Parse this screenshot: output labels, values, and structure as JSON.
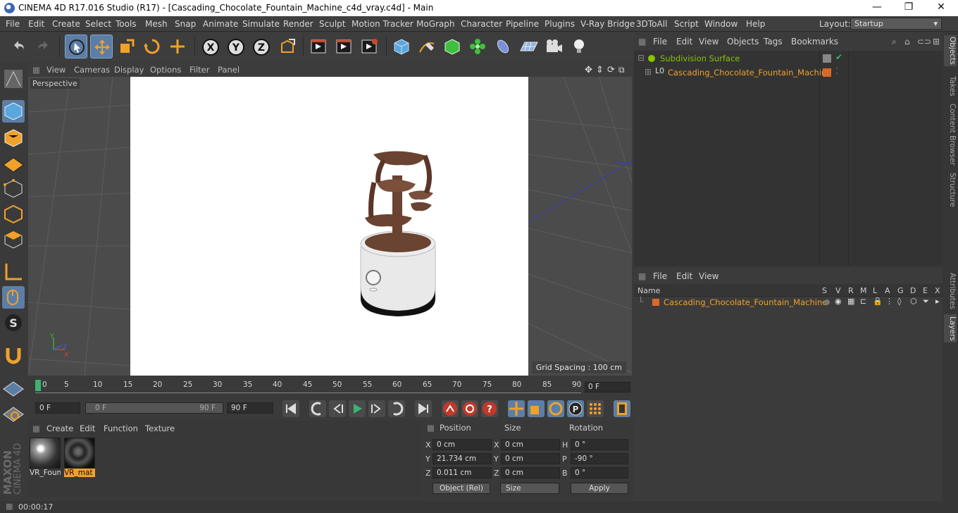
{
  "titlebar": {
    "title": "CINEMA 4D R17.016 Studio (R17) - [Cascading_Chocolate_Fountain_Machine_c4d_vray.c4d] - Main",
    "minimize": "—",
    "maximize": "❐",
    "close": "✕"
  },
  "menu": [
    "File",
    "Edit",
    "Create",
    "Select",
    "Tools",
    "Mesh",
    "Snap",
    "Animate",
    "Simulate",
    "Render",
    "Sculpt",
    "Motion Tracker",
    "MoGraph",
    "Character",
    "Pipeline",
    "Plugins",
    "V-Ray Bridge",
    "3DToAll",
    "Script",
    "Window",
    "Help"
  ],
  "layout": {
    "label": "Layout:",
    "value": "Startup"
  },
  "viewport": {
    "menu": [
      "View",
      "Cameras",
      "Display",
      "Options",
      "Filter",
      "Panel"
    ],
    "camera": "Perspective",
    "grid_spacing": "Grid Spacing : 100 cm",
    "axis_x": "X",
    "axis_y": "Y",
    "axis_z": "Z"
  },
  "timeline": {
    "ticks": [
      "0",
      "5",
      "10",
      "15",
      "20",
      "25",
      "30",
      "35",
      "40",
      "45",
      "50",
      "55",
      "60",
      "65",
      "70",
      "75",
      "80",
      "85",
      "90"
    ],
    "current_frame": "0 F"
  },
  "playbar": {
    "start": "0 F",
    "range_start": "0 F",
    "range_end": "90 F",
    "end": "90 F"
  },
  "material_manager": {
    "menu": [
      "Create",
      "Edit",
      "Function",
      "Texture"
    ],
    "materials": [
      {
        "label": "VR_Foun"
      },
      {
        "label": "VR_mat"
      }
    ]
  },
  "coordinates": {
    "headers": {
      "position": "Position",
      "size": "Size",
      "rotation": "Rotation"
    },
    "rows": [
      {
        "axis": "X",
        "pos": "0 cm",
        "size_axis": "X",
        "size": "0 cm",
        "rot_axis": "H",
        "rot": "0 °"
      },
      {
        "axis": "Y",
        "pos": "21.734 cm",
        "size_axis": "Y",
        "size": "0 cm",
        "rot_axis": "P",
        "rot": "-90 °"
      },
      {
        "axis": "Z",
        "pos": "0.011 cm",
        "size_axis": "Z",
        "size": "0 cm",
        "rot_axis": "B",
        "rot": "0 °"
      }
    ],
    "mode": "Object (Rel)",
    "size_mode": "Size",
    "apply": "Apply"
  },
  "object_manager": {
    "menu": [
      "File",
      "Edit",
      "View",
      "Objects",
      "Tags",
      "Bookmarks"
    ],
    "objects": [
      {
        "name": "Subdivision Surface"
      },
      {
        "name": "Cascading_Chocolate_Fountain_Machine"
      }
    ]
  },
  "layer_manager": {
    "menu": [
      "File",
      "Edit",
      "View"
    ],
    "columns": {
      "name": "Name",
      "flags": [
        "S",
        "V",
        "R",
        "M",
        "L",
        "A",
        "G",
        "D",
        "E",
        "X"
      ]
    },
    "layers": [
      {
        "name": "Cascading_Chocolate_Fountain_Machine",
        "color": "#d8692a"
      }
    ]
  },
  "side_tabs": [
    "Objects",
    "Takes",
    "Content Browser",
    "Structure",
    "Attributes",
    "Layers"
  ],
  "status": {
    "time": "00:00:17"
  },
  "branding": {
    "maxon": "MAXON",
    "product": "CINEMA 4D"
  },
  "colors": {
    "accent": "#5c7ea6",
    "highlight_text": "#f0a12a",
    "object_green": "#88c400"
  }
}
